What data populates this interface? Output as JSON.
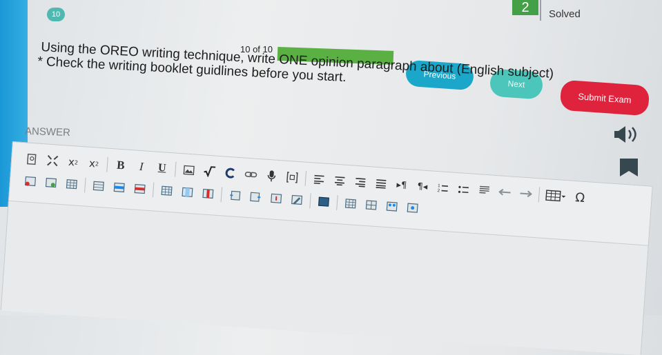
{
  "header": {
    "question_badge": "10",
    "solved_count": "2",
    "solved_label": "Solved"
  },
  "progress": {
    "text": "10 of 10",
    "value": 1.0
  },
  "nav": {
    "previous_label": "Previous",
    "next_label": "Next",
    "submit_label": "Submit Exam"
  },
  "question": {
    "line1": "Using the OREO writing technique, write ONE opinion paragraph about (English subject)",
    "line2": "* Check the writing booklet guidlines before you start."
  },
  "answer": {
    "label": "ANSWER"
  },
  "toolbar": {
    "subscript_label": "x",
    "superscript_label": "x",
    "bold_label": "B",
    "italic_label": "I",
    "underline_label": "U",
    "special_char_label": "Ω"
  },
  "colors": {
    "progress_fill": "#5ab043",
    "previous_button": "#1aa7c9",
    "next_button": "#4cc6ba",
    "submit_button": "#e0233c",
    "solved_badge": "#43a047"
  }
}
